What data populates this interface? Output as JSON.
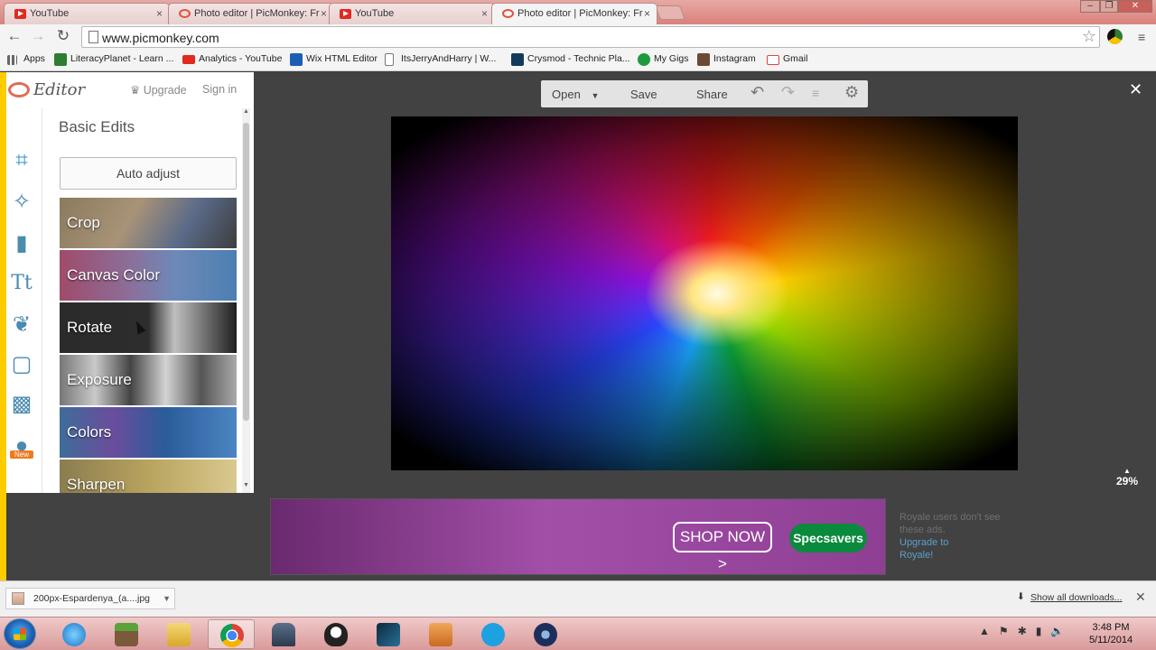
{
  "browser": {
    "tabs": [
      {
        "title": "YouTube",
        "icon": "youtube-icon",
        "active": false
      },
      {
        "title": "Photo editor | PicMonkey: Fr",
        "icon": "picmonkey-icon",
        "active": false
      },
      {
        "title": "YouTube",
        "icon": "youtube-icon",
        "active": false
      },
      {
        "title": "Photo editor | PicMonkey: Fr",
        "icon": "picmonkey-icon",
        "active": true
      }
    ],
    "url": "www.picmonkey.com",
    "bookmarks": [
      {
        "label": "Apps",
        "icon": "apps-grid-icon"
      },
      {
        "label": "LiteracyPlanet - Learn ...",
        "icon": "literacyplanet-icon"
      },
      {
        "label": "Analytics - YouTube",
        "icon": "youtube-icon"
      },
      {
        "label": "Wix HTML Editor",
        "icon": "wix-icon"
      },
      {
        "label": "ItsJerryAndHarry | W...",
        "icon": "page-icon"
      },
      {
        "label": "Crysmod - Technic Pla...",
        "icon": "crysmod-icon"
      },
      {
        "label": "My Gigs",
        "icon": "gigs-icon"
      },
      {
        "label": "Instagram",
        "icon": "instagram-icon"
      },
      {
        "label": "Gmail",
        "icon": "gmail-icon"
      }
    ]
  },
  "editor": {
    "logo_text": "Editor",
    "upgrade": "Upgrade",
    "sign_in": "Sign in",
    "panel_title": "Basic Edits",
    "auto_adjust": "Auto adjust",
    "tools": [
      "Crop",
      "Canvas Color",
      "Rotate",
      "Exposure",
      "Colors",
      "Sharpen"
    ],
    "rail_icons": [
      "crop-icon",
      "magic-wand-icon",
      "brush-icon",
      "text-icon",
      "butterfly-icon",
      "frame-icon",
      "texture-icon",
      "pumpkin-icon"
    ],
    "new_badge": "New",
    "toolbar": {
      "open": "Open",
      "save": "Save",
      "share": "Share"
    },
    "zoom": "29%",
    "accent": "#ffcc00"
  },
  "ad": {
    "shop_now": "SHOP NOW >",
    "brand": "Specsavers",
    "royale_text": "Royale users don't see these ads.",
    "royale_link1": "Upgrade to",
    "royale_link2": "Royale!"
  },
  "downloads": {
    "file": "200px-Espardenya_(a....jpg",
    "show_all": "Show all downloads..."
  },
  "taskbar": {
    "time": "3:48 PM",
    "date": "5/11/2014"
  }
}
